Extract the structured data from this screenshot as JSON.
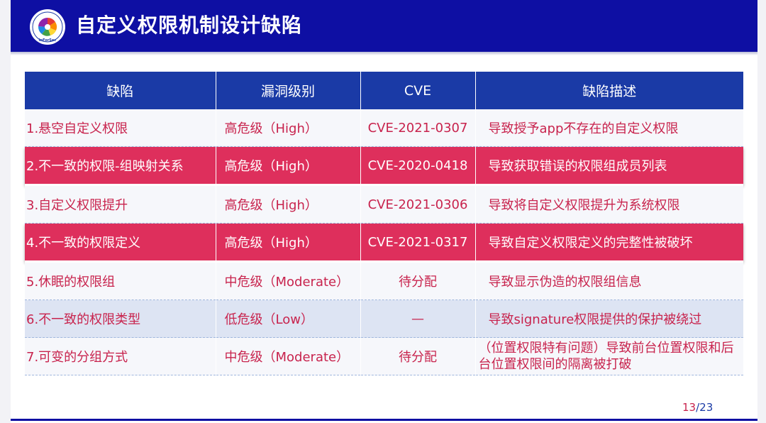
{
  "header": {
    "title": "自定义权限机制设计缺陷",
    "logo_text": "InForSec",
    "background_color": "#0e0fa3"
  },
  "table": {
    "columns": [
      "缺陷",
      "漏洞级别",
      "CVE",
      "缺陷描述"
    ],
    "rows": [
      {
        "defect": "1.悬空自定义权限",
        "level": "高危级（High）",
        "cve": "CVE-2021-0307",
        "description": "导致授予app不存在的自定义权限",
        "highlighted": false
      },
      {
        "defect": "2.不一致的权限-组映射关系",
        "level": "高危级（High）",
        "cve": "CVE-2020-0418",
        "description": "导致获取错误的权限组成员列表",
        "highlighted": true
      },
      {
        "defect": "3.自定义权限提升",
        "level": "高危级（High）",
        "cve": "CVE-2021-0306",
        "description": "导致将自定义权限提升为系统权限",
        "highlighted": false
      },
      {
        "defect": "4.不一致的权限定义",
        "level": "高危级（High）",
        "cve": "CVE-2021-0317",
        "description": "导致自定义权限定义的完整性被破坏",
        "highlighted": true
      },
      {
        "defect": "5.休眠的权限组",
        "level": "中危级（Moderate）",
        "cve": "待分配",
        "description": "导致显示伪造的权限组信息",
        "highlighted": false
      },
      {
        "defect": "6.不一致的权限类型",
        "level": "低危级（Low）",
        "cve": "—",
        "description": "导致signature权限提供的保护被绕过",
        "highlighted": false
      },
      {
        "defect": "7.可变的分组方式",
        "level": "中危级（Moderate）",
        "cve": "待分配",
        "description": "（位置权限特有问题）导致前台位置权限和后台位置权限间的隔离被打破",
        "highlighted": false
      }
    ],
    "colors": {
      "header": "#1a3aa6",
      "highlight": "#de2f5c",
      "text": "#c8234d",
      "pale_row": "#dde4f3"
    }
  },
  "pager": {
    "current": "13",
    "separator": "/",
    "total": "23"
  }
}
